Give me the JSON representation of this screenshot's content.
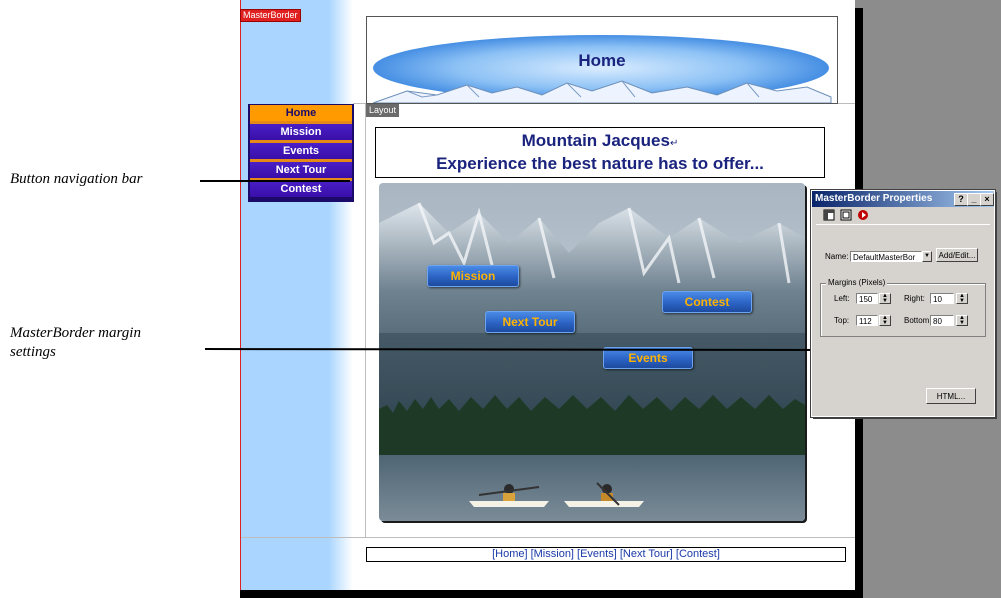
{
  "callouts": {
    "nav_bar": "Button navigation bar",
    "margin_line1": "MasterBorder margin",
    "margin_line2": "settings"
  },
  "page": {
    "masterborder_tag": "MasterBorder",
    "layout_tag": "Layout",
    "banner_title": "Home",
    "heading_line1": "Mountain Jacques",
    "heading_return_mark": "↵",
    "heading_line2": "Experience the best nature has to offer...",
    "footer_links": "[Home] [Mission] [Events] [Next Tour] [Contest]"
  },
  "nav": {
    "items": [
      {
        "label": "Home",
        "active": true
      },
      {
        "label": "Mission",
        "active": false
      },
      {
        "label": "Events",
        "active": false
      },
      {
        "label": "Next Tour",
        "active": false
      },
      {
        "label": "Contest",
        "active": false
      }
    ]
  },
  "image_buttons": {
    "mission": "Mission",
    "contest": "Contest",
    "next_tour": "Next Tour",
    "events": "Events"
  },
  "dialog": {
    "title": "MasterBorder Properties",
    "help_btn": "?",
    "min_btn": "_",
    "close_btn": "×",
    "name_label": "Name:",
    "name_value": "DefaultMasterBor",
    "add_edit_btn": "Add/Edit...",
    "margins_legend": "Margins (Pixels)",
    "left_label": "Left:",
    "left_value": "150",
    "right_label": "Right:",
    "right_value": "10",
    "top_label": "Top:",
    "top_value": "112",
    "bottom_label": "Bottom",
    "bottom_value": "80",
    "html_btn": "HTML..."
  },
  "colors": {
    "nav_bg": "#3a0ea8",
    "nav_active": "#ff9a00",
    "accent_text": "#1a237e",
    "link": "#1a3aa8"
  }
}
